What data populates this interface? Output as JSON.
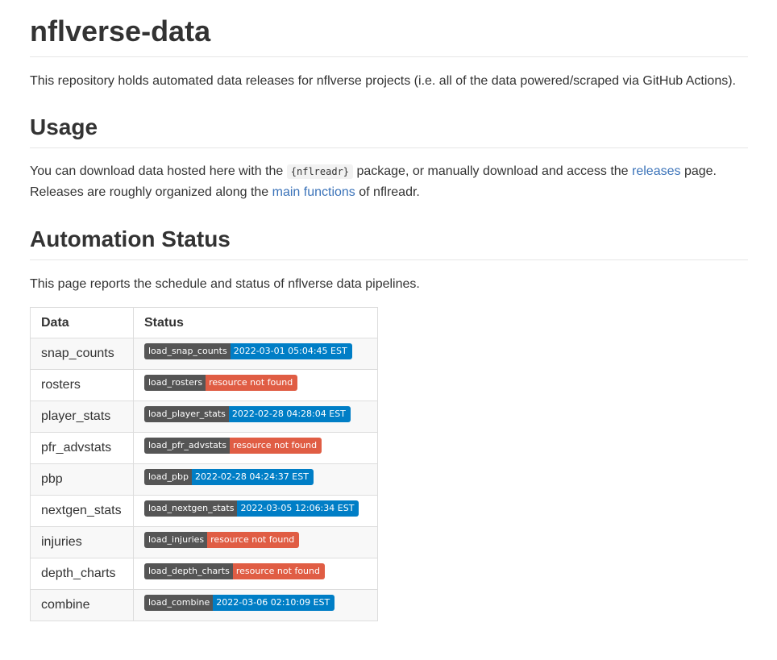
{
  "title": "nflverse-data",
  "intro": "This repository holds automated data releases for nflverse projects (i.e. all of the data powered/scraped via GitHub Actions).",
  "usage": {
    "heading": "Usage",
    "text_1": "You can download data hosted here with the ",
    "code": "{nflreadr}",
    "text_2": " package, or manually download and access the ",
    "link_releases": "releases",
    "text_3": " page. Releases are roughly organized along the ",
    "link_main_functions": "main functions",
    "text_4": " of nflreadr."
  },
  "automation": {
    "heading": "Automation Status",
    "text": "This page reports the schedule and status of nflverse data pipelines."
  },
  "colors": {
    "success": "#007ec6",
    "error": "#e05d44",
    "label": "#555555",
    "link": "#3b73b9"
  },
  "table": {
    "headers": [
      "Data",
      "Status"
    ],
    "rows": [
      {
        "data": "snap_counts",
        "badge_label": "load_snap_counts",
        "badge_message": "2022-03-01 05:04:45 EST",
        "state": "success"
      },
      {
        "data": "rosters",
        "badge_label": "load_rosters",
        "badge_message": "resource not found",
        "state": "error"
      },
      {
        "data": "player_stats",
        "badge_label": "load_player_stats",
        "badge_message": "2022-02-28 04:28:04 EST",
        "state": "success"
      },
      {
        "data": "pfr_advstats",
        "badge_label": "load_pfr_advstats",
        "badge_message": "resource not found",
        "state": "error"
      },
      {
        "data": "pbp",
        "badge_label": "load_pbp",
        "badge_message": "2022-02-28 04:24:37 EST",
        "state": "success"
      },
      {
        "data": "nextgen_stats",
        "badge_label": "load_nextgen_stats",
        "badge_message": "2022-03-05 12:06:34 EST",
        "state": "success"
      },
      {
        "data": "injuries",
        "badge_label": "load_injuries",
        "badge_message": "resource not found",
        "state": "error"
      },
      {
        "data": "depth_charts",
        "badge_label": "load_depth_charts",
        "badge_message": "resource not found",
        "state": "error"
      },
      {
        "data": "combine",
        "badge_label": "load_combine",
        "badge_message": "2022-03-06 02:10:09 EST",
        "state": "success"
      }
    ]
  }
}
